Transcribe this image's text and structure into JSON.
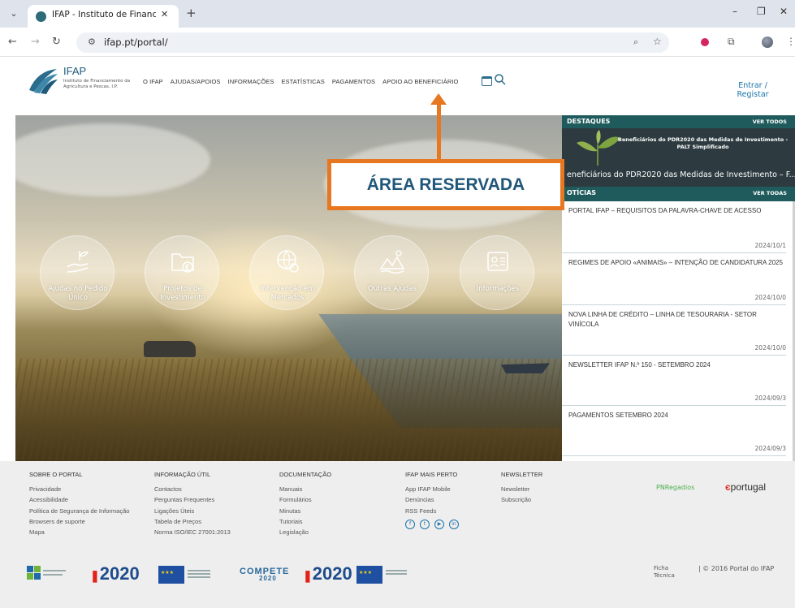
{
  "browser": {
    "tab_title": "IFAP - Instituto de Financiamen",
    "tab_close": "✕",
    "new_tab": "+",
    "menu_chevron": "⌄",
    "win_minimize": "–",
    "win_restore": "❐",
    "win_close": "✕",
    "url": "ifap.pt/portal/",
    "icons": [
      "back-icon",
      "forward-icon",
      "reload-icon",
      "site-info-icon",
      "zoom-icon",
      "star-icon",
      "extension-icon",
      "puzzle-icon",
      "avatar",
      "menu-icon"
    ]
  },
  "header": {
    "logo_name": "IFAP",
    "logo_sub": "Instituto de Financiamento da Agricultura e Pescas, I.P.",
    "nav": [
      "O IFAP",
      "AJUDAS/APOIOS",
      "INFORMAÇÕES",
      "ESTATÍSTICAS",
      "PAGAMENTOS",
      "APOIO AO BENEFICIÁRIO"
    ],
    "login_line1": "Entrar /",
    "login_line2": "Registar"
  },
  "hero": {
    "links": [
      {
        "label": "Ajudas no Pedido Único",
        "icon": "hand-plant-icon"
      },
      {
        "label": "Projetos de Investimento",
        "icon": "folder-euro-icon"
      },
      {
        "label": "Intervenção em Mercados",
        "icon": "globe-market-icon"
      },
      {
        "label": "Outras Ajudas",
        "icon": "landscape-icon"
      },
      {
        "label": "Informações",
        "icon": "id-card-icon"
      }
    ]
  },
  "annotation": {
    "text": "ÁREA RESERVADA",
    "color": "#e87722"
  },
  "destaques": {
    "title": "DESTAQUES",
    "more": "VER TODOS",
    "banner": "Beneficiários do PDR2020 das Medidas de Investimento - PALT Simplificado",
    "caption": "eneficiários do PDR2020 das Medidas de Investimento – F..."
  },
  "noticias": {
    "title": "OTÍCIAS",
    "more": "VER TODAS",
    "items": [
      {
        "title": "PORTAL IFAP – REQUISITOS DA PALAVRA-CHAVE DE ACESSO",
        "date": "2024/10/1"
      },
      {
        "title": "REGIMES DE APOIO «ANIMAIS» – INTENÇÃO DE CANDIDATURA 2025",
        "date": "2024/10/0"
      },
      {
        "title": "NOVA LINHA DE CRÉDITO – LINHA DE TESOURARIA - SETOR VINÍCOLA",
        "date": "2024/10/0"
      },
      {
        "title": "NEWSLETTER IFAP N.º 150 - SETEMBRO 2024",
        "date": "2024/09/3"
      },
      {
        "title": "PAGAMENTOS SETEMBRO 2024",
        "date": "2024/09/3"
      }
    ]
  },
  "footer": {
    "columns": [
      {
        "head": "SOBRE O PORTAL",
        "links": [
          "Privacidade",
          "Acessibilidade",
          "Política de Segurança de Informação",
          "Browsers de suporte",
          "Mapa"
        ]
      },
      {
        "head": "INFORMAÇÃO ÚTIL",
        "links": [
          "Contactos",
          "Perguntas Frequentes",
          "Ligações Úteis",
          "Tabela de Preços",
          "Norma ISO/IEC 27001:2013"
        ]
      },
      {
        "head": "DOCUMENTAÇÃO",
        "links": [
          "Manuais",
          "Formulários",
          "Minutas",
          "Tutoriais",
          "Legislação"
        ]
      },
      {
        "head": "IFAP MAIS PERTO",
        "links": [
          "App IFAP Mobile",
          "Denúncias",
          "RSS Feeds"
        ]
      },
      {
        "head": "NEWSLETTER",
        "links": [
          "Newsletter",
          "Subscrição"
        ]
      }
    ],
    "social": [
      "f",
      "t",
      "▶",
      "in"
    ],
    "pnr": "PNRegadios",
    "portugal_e": "є",
    "portugal": "portugal",
    "fund_2020_a": "2020",
    "fund_compete": "COMPETE",
    "fund_compete_year": "2020",
    "fund_2020_b": "2020",
    "ficha": "Ficha Técnica",
    "copyright": "| © 2016 Portal do IFAP"
  }
}
